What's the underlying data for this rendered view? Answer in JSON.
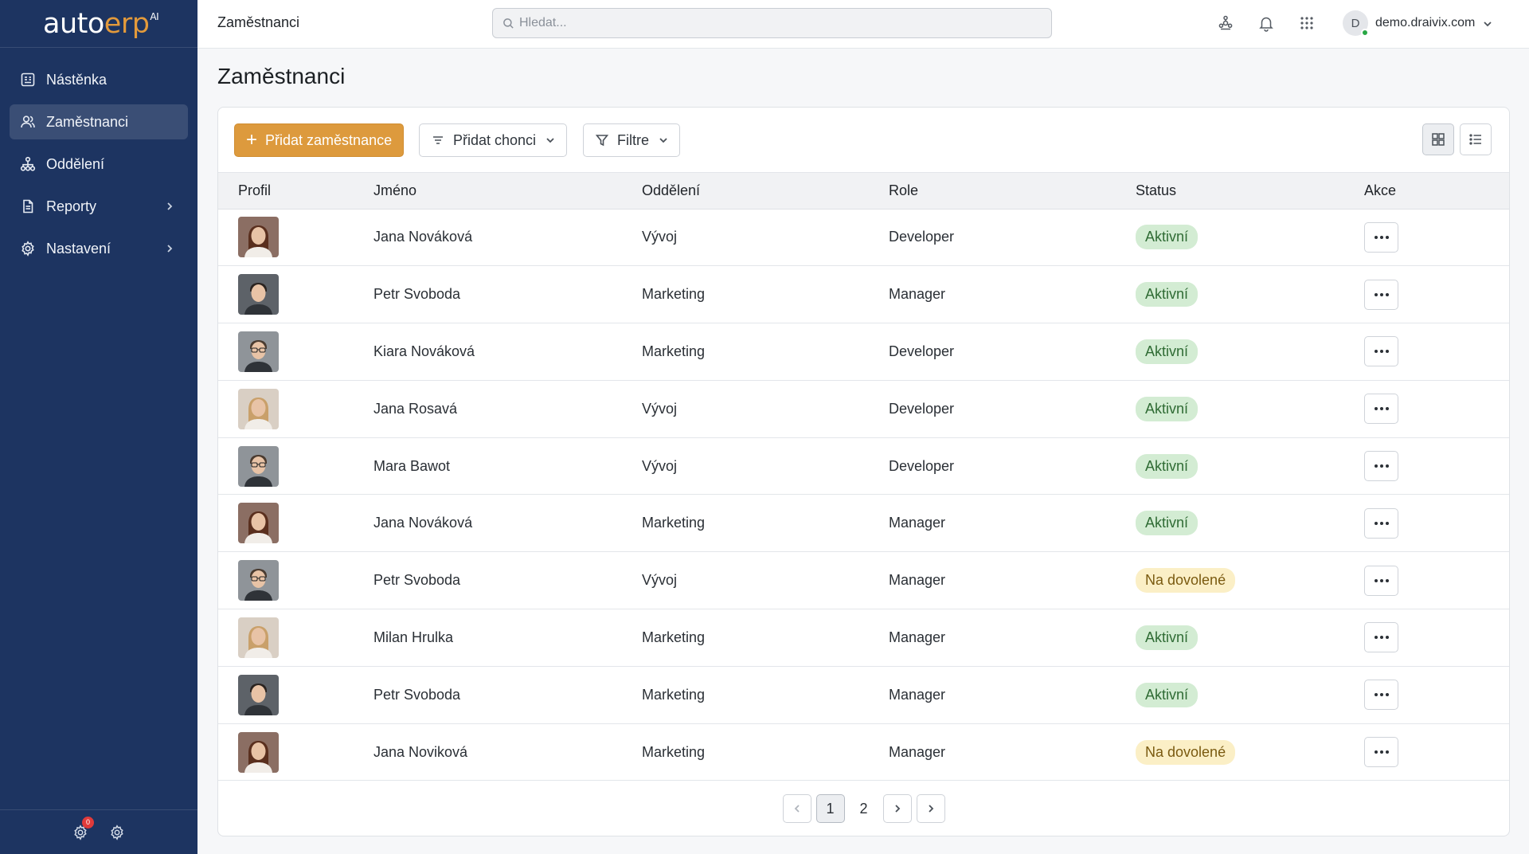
{
  "app": {
    "logo_main": "auto",
    "logo_accent": "erp",
    "logo_sup": "AI"
  },
  "sidebar": {
    "items": [
      {
        "label": "Nástěnka",
        "icon": "dashboard-icon",
        "active": false,
        "has_children": false
      },
      {
        "label": "Zaměstnanci",
        "icon": "users-icon",
        "active": true,
        "has_children": false
      },
      {
        "label": "Oddělení",
        "icon": "org-chart-icon",
        "active": false,
        "has_children": false
      },
      {
        "label": "Reporty",
        "icon": "document-icon",
        "active": false,
        "has_children": true
      },
      {
        "label": "Nastavení",
        "icon": "gear-icon",
        "active": false,
        "has_children": true
      }
    ],
    "bottom": {
      "notifications_badge": "0"
    }
  },
  "header": {
    "title": "Zaměstnanci",
    "search_placeholder": "Hledat...",
    "user_initial": "D",
    "user_name": "demo.draivix.com"
  },
  "main": {
    "page_title": "Zaměstnanci",
    "toolbar": {
      "add_label": "Přidat zaměstnance",
      "sort_label": "Přidat chonci",
      "filter_label": "Filtre"
    },
    "table": {
      "columns": [
        "Profil",
        "Jméno",
        "Oddělení",
        "Role",
        "Status",
        "Akce"
      ],
      "rows": [
        {
          "name": "Jana Nováková",
          "dept": "Vývoj",
          "role": "Developer",
          "status": "Aktivní",
          "status_type": "active",
          "avatar": "female"
        },
        {
          "name": "Petr Svoboda",
          "dept": "Marketing",
          "role": "Manager",
          "status": "Aktivní",
          "status_type": "active",
          "avatar": "male"
        },
        {
          "name": "Kiara Nováková",
          "dept": "Marketing",
          "role": "Developer",
          "status": "Aktivní",
          "status_type": "active",
          "avatar": "male-glasses"
        },
        {
          "name": "Jana Rosavá",
          "dept": "Vývoj",
          "role": "Developer",
          "status": "Aktivní",
          "status_type": "active",
          "avatar": "female-light"
        },
        {
          "name": "Mara Bawot",
          "dept": "Vývoj",
          "role": "Developer",
          "status": "Aktivní",
          "status_type": "active",
          "avatar": "male-glasses"
        },
        {
          "name": "Jana Nováková",
          "dept": "Marketing",
          "role": "Manager",
          "status": "Aktivní",
          "status_type": "active",
          "avatar": "female"
        },
        {
          "name": "Petr Svoboda",
          "dept": "Vývoj",
          "role": "Manager",
          "status": "Na dovolené",
          "status_type": "vacation",
          "avatar": "male-glasses"
        },
        {
          "name": "Milan Hrulka",
          "dept": "Marketing",
          "role": "Manager",
          "status": "Aktivní",
          "status_type": "active",
          "avatar": "female-light"
        },
        {
          "name": "Petr Svoboda",
          "dept": "Marketing",
          "role": "Manager",
          "status": "Aktivní",
          "status_type": "active",
          "avatar": "male"
        },
        {
          "name": "Jana Noviková",
          "dept": "Marketing",
          "role": "Manager",
          "status": "Na dovolené",
          "status_type": "vacation",
          "avatar": "female"
        }
      ]
    },
    "pagination": {
      "pages": [
        "1",
        "2"
      ],
      "current": "1"
    }
  },
  "colors": {
    "sidebar_bg": "#1d3461",
    "accent": "#dd9a3d",
    "active_badge_bg": "#d3ecd3",
    "vacation_badge_bg": "#fbefc6"
  }
}
